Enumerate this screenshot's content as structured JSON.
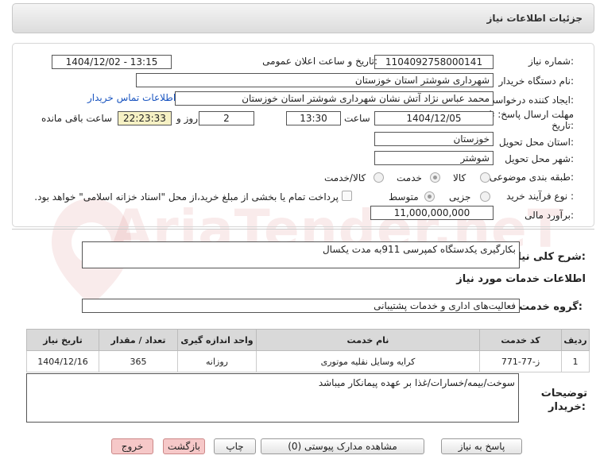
{
  "header": {
    "title": "جزئیات اطلاعات نیاز"
  },
  "form": {
    "need_number_label": "شماره نیاز:",
    "need_number": "1104092758000141",
    "announce_label": "تاریخ و ساعت اعلان عمومی:",
    "announce_value": "1404/12/02 - 13:15",
    "buyer_org_label": "نام دستگاه خریدار:",
    "buyer_org": "شهرداری شوشتر استان خوزستان",
    "creator_label": "ایجاد کننده درخواست:",
    "creator": "محمد عباس نژاد آتش نشان شهرداری شوشتر استان خوزستان",
    "contact_link": "اطلاعات تماس خریدار",
    "deadline_label_1": "مهلت ارسال پاسخ: تا",
    "deadline_label_2": "تاریخ:",
    "deadline_date": "1404/12/05",
    "time_label": "ساعت",
    "deadline_time": "13:30",
    "days_value": "2",
    "days_label": "روز و",
    "remaining_time": "22:23:33",
    "remaining_label": "ساعت باقی مانده",
    "province_label": "استان محل تحویل:",
    "province": "خوزستان",
    "city_label": "شهر محل تحویل:",
    "city": "شوشتر",
    "category_label": "طبقه بندی موضوعی:",
    "category_options": [
      "کالا",
      "خدمت",
      "کالا/خدمت"
    ],
    "category_selected": "خدمت",
    "process_label": "نوع فرآیند خرید :",
    "process_options": [
      "جزیی",
      "متوسط"
    ],
    "process_selected": "متوسط",
    "payment_note": "پرداخت تمام یا بخشی از مبلغ خرید،از محل \"اسناد خزانه اسلامی\" خواهد بود.",
    "estimate_label": "برآورد مالی:",
    "estimate": "11,000,000,000"
  },
  "description": {
    "label": "شرح کلی نیاز:",
    "value": "بکارگیری یکدستگاه کمپرسی 911به مدت یکسال"
  },
  "services": {
    "section_title": "اطلاعات خدمات مورد نیاز",
    "group_label": "گروه خدمت:",
    "group_value": "فعالیت‌های اداری و خدمات پشتیبانی",
    "columns": [
      "ردیف",
      "کد خدمت",
      "نام خدمت",
      "واحد اندازه گیری",
      "تعداد / مقدار",
      "تاریخ نیاز"
    ],
    "rows": [
      [
        "1",
        "ز-77-771",
        "کرایه وسایل نقلیه موتوری",
        "روزانه",
        "365",
        "1404/12/16"
      ]
    ]
  },
  "buyer_notes": {
    "label_1": "توضیحات",
    "label_2": "خریدار:",
    "value": "سوخت/بیمه/خسارات/غذا بر عهده پیمانکار میباشد"
  },
  "buttons": {
    "reply": "پاسخ به نیاز",
    "view_docs": "مشاهده مدارک پیوستی (0)",
    "print": "چاپ",
    "back": "بازگشت",
    "exit": "خروج"
  },
  "watermark": "AriaTender.neT"
}
